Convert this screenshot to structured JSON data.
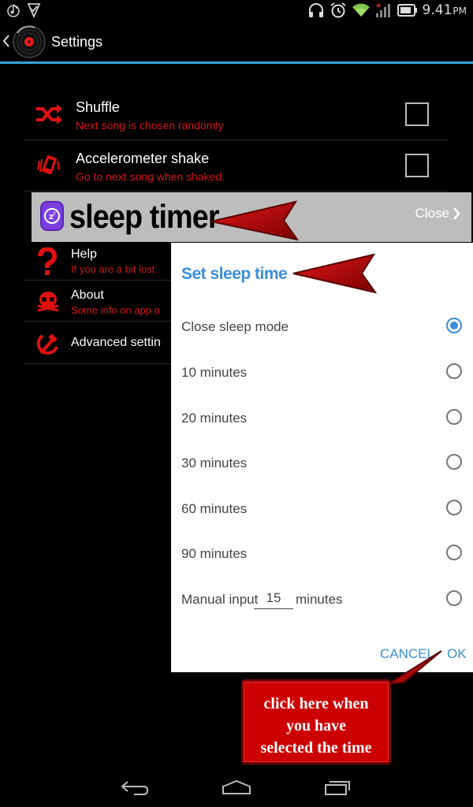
{
  "status_bar": {
    "time": "9.41",
    "ampm": "PM",
    "icons": [
      "music-note-icon",
      "check-shield-icon",
      "headphones-icon",
      "alarm-icon",
      "wifi-icon",
      "signal-icon",
      "battery-icon"
    ]
  },
  "action_bar": {
    "title": "Settings",
    "icons": [
      "back-chevron-icon",
      "vinyl-record-icon"
    ]
  },
  "settings": {
    "shuffle": {
      "title": "Shuffle",
      "subtitle": "Next song is chosen randomly",
      "checked": false
    },
    "accelerometer": {
      "title": "Accelerometer shake",
      "subtitle": "Go to next song when shaked.",
      "checked": false
    },
    "sleep_timer": {
      "title": "sleep timer",
      "state": "Close"
    },
    "help": {
      "title": "Help",
      "subtitle": "If you are a bit lost."
    },
    "about": {
      "title": "About",
      "subtitle": "Some info on app a"
    },
    "advanced": {
      "title": "Advanced settin"
    }
  },
  "dialog": {
    "title": "Set sleep time",
    "options": [
      {
        "label": "Close sleep mode",
        "selected": true
      },
      {
        "label": "10 minutes",
        "selected": false
      },
      {
        "label": "20 minutes",
        "selected": false
      },
      {
        "label": "30 minutes",
        "selected": false
      },
      {
        "label": "60 minutes",
        "selected": false
      },
      {
        "label": "90 minutes",
        "selected": false
      }
    ],
    "manual": {
      "label": "Manual input",
      "value": "15",
      "unit": "minutes",
      "selected": false
    },
    "cancel_label": "CANCEL",
    "ok_label": "OK"
  },
  "callout": {
    "lines": [
      "click here when",
      "you have",
      "selected the time"
    ]
  },
  "nav_bar": {
    "icons": [
      "back-icon",
      "home-icon",
      "recent-apps-icon"
    ]
  },
  "colors": {
    "accent": "#3a8fd8",
    "subtitle_red": "#d01818",
    "arrow_red": "#b00000",
    "row_highlight": "#bdbdbd"
  }
}
